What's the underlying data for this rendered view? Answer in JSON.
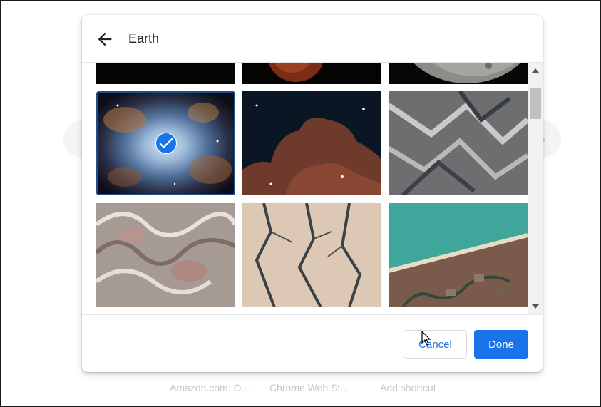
{
  "dialog": {
    "title": "Earth",
    "cancel_label": "Cancel",
    "done_label": "Done"
  },
  "background_shortcuts": [
    {
      "label": "Amazon.com: O..."
    },
    {
      "label": "Chrome Web St..."
    },
    {
      "label": "Add shortcut"
    }
  ],
  "tiles": [
    {
      "name": "space-planet-edge",
      "selected": false
    },
    {
      "name": "mars-horizon",
      "selected": false
    },
    {
      "name": "moon-surface",
      "selected": false
    },
    {
      "name": "nebula",
      "selected": true
    },
    {
      "name": "horsehead-nebula",
      "selected": false
    },
    {
      "name": "mountain-ridges",
      "selected": false
    },
    {
      "name": "swirl-terrain",
      "selected": false
    },
    {
      "name": "river-canyons",
      "selected": false
    },
    {
      "name": "coastal-delta",
      "selected": false
    }
  ],
  "colors": {
    "accent": "#1a73e8",
    "selected_border": "#1f4e8f"
  }
}
